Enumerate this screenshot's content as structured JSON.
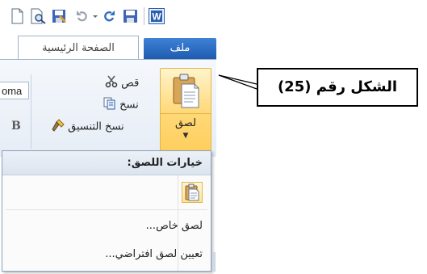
{
  "qat": {
    "icons": [
      "new-document-icon",
      "print-preview-icon",
      "save-as-icon",
      "undo-icon",
      "dropdown-arrow-icon",
      "redo-icon",
      "save-icon",
      "word-icon"
    ]
  },
  "tabs": {
    "file_label": "ملف",
    "home_label": "الصفحة الرئيسية"
  },
  "clipboard": {
    "cut_label": "قص",
    "copy_label": "نسخ",
    "format_painter_label": "نسخ التنسيق",
    "paste_label": "لصق"
  },
  "font": {
    "font_name_fragment": "oma",
    "bold_label": "B"
  },
  "paste_menu": {
    "header": "خيارات اللصق:",
    "items": [
      "لصق خاص...",
      "تعيين لصق افتراضي..."
    ]
  },
  "callout": {
    "text": "الشكل رقم (25)"
  },
  "colors": {
    "file_tab": "#2a6cc2",
    "paste_highlight": "#ffd877"
  }
}
